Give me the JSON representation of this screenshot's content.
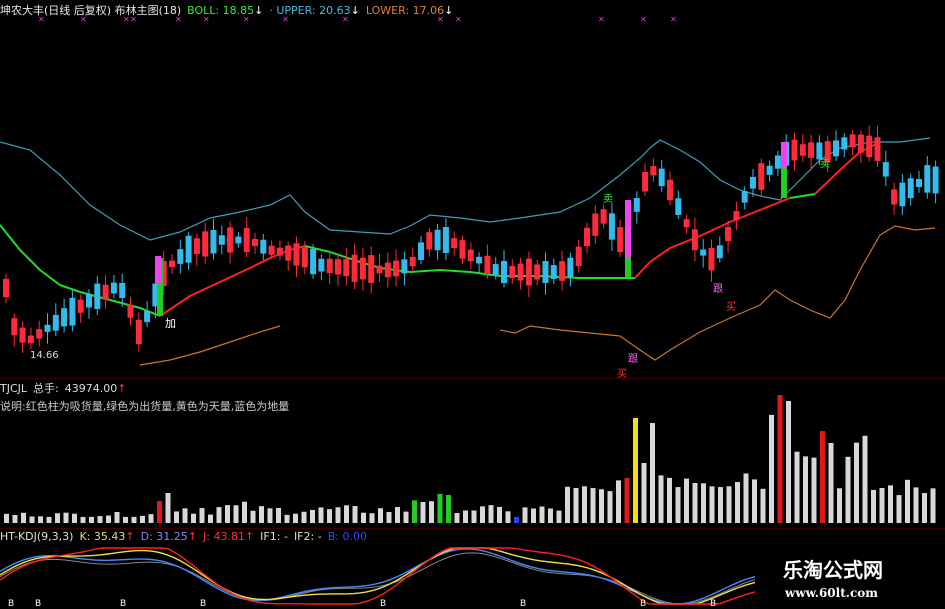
{
  "colors": {
    "up": "#ff2a3a",
    "down": "#33bbee",
    "mid_line_up": "#ff2020",
    "mid_line_down": "#22dd22",
    "upper_line": "#3aa0b8",
    "lower_line": "#c8762e",
    "vol_gray": "#d8d8d8",
    "vol_red": "#e01818",
    "vol_green": "#22cc22",
    "vol_yellow": "#f2e010",
    "vol_blue": "#2244ff",
    "k_line": "#f4f0a0",
    "d_line": "#8888ff",
    "j_line": "#ff2020",
    "yellow_curve": "#f2e040",
    "blue_curve": "#4488ff"
  },
  "price_panel": {
    "title": "坤农大丰(日线 后复权) 布林主图(18)",
    "boll": {
      "label": "BOLL:",
      "value": "18.85",
      "arrow": "↓",
      "color": "#33ee33"
    },
    "upper": {
      "label": "· UPPER:",
      "value": "20.63",
      "arrow": "↓",
      "color": "#44aacc"
    },
    "lower": {
      "label": "LOWER:",
      "value": "17.06",
      "arrow": "↓",
      "color": "#e08030"
    },
    "low_marker": "14.66",
    "signal_labels": [
      {
        "text": "加",
        "color": "#ffffff"
      },
      {
        "text": "跟",
        "color": "#ff66ff"
      },
      {
        "text": "跟",
        "color": "#ff66ff"
      },
      {
        "text": "买",
        "color": "#ff3333"
      },
      {
        "text": "买",
        "color": "#ff3333"
      },
      {
        "text": "卖",
        "color": "#33ee33"
      },
      {
        "text": "卖",
        "color": "#33ee33"
      }
    ]
  },
  "volume_panel": {
    "name": "TJCJL",
    "total_label": "总手:",
    "total_value": "43974.00",
    "total_arrow": "↑",
    "note": "说明:红色柱为吸货量,绿色为出货量,黄色为天量,蓝色为地量"
  },
  "kdj_panel": {
    "name": "HT-KDJ(9,3,3)",
    "k": {
      "label": "K:",
      "value": "35.43",
      "arrow": "↑",
      "color": "#dddd88"
    },
    "d": {
      "label": "D:",
      "value": "31.25",
      "arrow": "↑",
      "color": "#8888ff"
    },
    "j": {
      "label": "J:",
      "value": "43.81",
      "arrow": "↑",
      "color": "#ff3030"
    },
    "if1": {
      "label": "IF1:",
      "value": "-",
      "color": "#dddddd"
    },
    "if2": {
      "label": "IF2:",
      "value": "-",
      "color": "#dddddd"
    },
    "b": {
      "label": "B:",
      "value": "0.00",
      "color": "#3344ff"
    },
    "b_marker": "B"
  },
  "watermark": {
    "name": "乐淘公式网",
    "url": "www.60lt.com"
  }
}
